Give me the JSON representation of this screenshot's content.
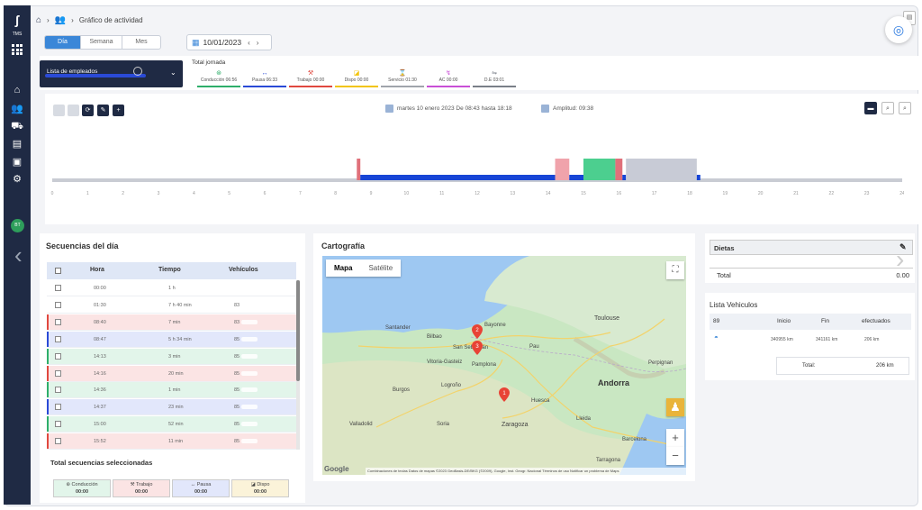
{
  "brand": {
    "logo_text": "ʃ",
    "logo_sub": "TMS"
  },
  "breadcrumb": {
    "current": "Gráfico de actividad"
  },
  "view_tabs": [
    "Día",
    "Semana",
    "Mes"
  ],
  "date_picker": {
    "value": "10/01/2023"
  },
  "employee_select": {
    "label": "Lista de empleados"
  },
  "totals": {
    "title": "Total jornada",
    "items": [
      {
        "label": "Conducción 06:56",
        "color": "#2eae6a",
        "icon": "steering-wheel-icon"
      },
      {
        "label": "Pausa 06:33",
        "color": "#2a4ad6",
        "icon": "pause-icon"
      },
      {
        "label": "Trabajo 00:00",
        "color": "#e0483f",
        "icon": "hammer-icon"
      },
      {
        "label": "Dispo 00:00",
        "color": "#f2c40c",
        "icon": "dispo-icon"
      },
      {
        "label": "Servicio 01:30",
        "color": "#a0a4ab",
        "icon": "hourglass-icon"
      },
      {
        "label": "AC 00:00",
        "color": "#c94fd6",
        "icon": "ac-icon"
      },
      {
        "label": "D.E 03:01",
        "color": "#7a7f88",
        "icon": "de-icon"
      }
    ]
  },
  "chart_info": {
    "range": "martes 10 enero 2023 De 08:43 hasta 18:18",
    "amplitude": "Amplitud: 09:38"
  },
  "chart_data": {
    "type": "bar",
    "title": "",
    "x_axis": {
      "min": 0,
      "max": 24,
      "ticks": [
        0,
        1,
        2,
        3,
        4,
        5,
        6,
        7,
        8,
        9,
        10,
        11,
        12,
        13,
        14,
        15,
        16,
        17,
        18,
        19,
        20,
        21,
        22,
        23,
        24
      ]
    },
    "segments": [
      {
        "start": 8.6,
        "end": 8.7,
        "level": "high",
        "color": "#e0707a"
      },
      {
        "start": 8.7,
        "end": 14.2,
        "level": "low",
        "color": "#1745d6"
      },
      {
        "start": 14.2,
        "end": 14.6,
        "level": "high",
        "color": "#f0a3ab"
      },
      {
        "start": 14.6,
        "end": 15.0,
        "level": "low",
        "color": "#1745d6"
      },
      {
        "start": 15.0,
        "end": 15.9,
        "level": "high",
        "color": "#4ccf8f"
      },
      {
        "start": 15.9,
        "end": 16.1,
        "level": "high",
        "color": "#e0707a"
      },
      {
        "start": 16.1,
        "end": 16.2,
        "level": "low",
        "color": "#1745d6"
      },
      {
        "start": 16.2,
        "end": 18.2,
        "level": "high",
        "color": "#c8cbd6"
      },
      {
        "start": 18.2,
        "end": 18.3,
        "level": "low",
        "color": "#1745d6"
      }
    ]
  },
  "sequences": {
    "title": "Secuencias del día",
    "columns": [
      "Hora",
      "Tiempo",
      "Vehículos"
    ],
    "rows": [
      {
        "hora": "00:00",
        "tiempo": "1 h",
        "vehiculo": "",
        "color": "#ffffff"
      },
      {
        "hora": "01:30",
        "tiempo": "7 h 40 min",
        "vehiculo": "83",
        "color": "#ffffff"
      },
      {
        "hora": "08:40",
        "tiempo": "7 min",
        "vehiculo": "83",
        "color": "#fbe4e4"
      },
      {
        "hora": "08:47",
        "tiempo": "5 h 34 min",
        "vehiculo": "85",
        "color": "#e2e7fb"
      },
      {
        "hora": "14:13",
        "tiempo": "3 min",
        "vehiculo": "85",
        "color": "#e2f5ea"
      },
      {
        "hora": "14:16",
        "tiempo": "20 min",
        "vehiculo": "85",
        "color": "#fbe4e4"
      },
      {
        "hora": "14:36",
        "tiempo": "1 min",
        "vehiculo": "85",
        "color": "#e2f5ea"
      },
      {
        "hora": "14:37",
        "tiempo": "23 min",
        "vehiculo": "85",
        "color": "#e2e7fb"
      },
      {
        "hora": "15:00",
        "tiempo": "52 min",
        "vehiculo": "85",
        "color": "#e2f5ea"
      },
      {
        "hora": "15:52",
        "tiempo": "11 min",
        "vehiculo": "85",
        "color": "#fbe4e4"
      }
    ]
  },
  "selected_totals": {
    "title": "Total secuencias seleccionadas",
    "items": [
      {
        "label": "Conducción",
        "value": "00:00",
        "color": "#e2f5ea",
        "icon": "steering-wheel-icon"
      },
      {
        "label": "Trabajo",
        "value": "00:00",
        "color": "#fbe4e4",
        "icon": "hammer-icon"
      },
      {
        "label": "Pausa",
        "value": "00:00",
        "color": "#e2e7fb",
        "icon": "pause-icon"
      },
      {
        "label": "Dispo",
        "value": "00:00",
        "color": "#fbf3d9",
        "icon": "dispo-icon"
      }
    ]
  },
  "map": {
    "title": "Cartografía",
    "tabs": [
      "Mapa",
      "Satélite"
    ],
    "labels": {
      "andorra": "Andorra",
      "zaragoza": "Zaragoza",
      "toulouse": "Toulouse",
      "bilbao": "Bilbao",
      "santander": "Santander",
      "barcelona": "Barcelona",
      "vitoria": "Vitoria-Gasteiz",
      "pamplona": "Pamplona",
      "huesca": "Huesca",
      "lleida": "Lleida",
      "valladolid": "Valladolid",
      "burgos": "Burgos",
      "logrono": "Logroño",
      "soria": "Soria",
      "san_sebastian": "San Sebastián",
      "bayonne": "Bayonne",
      "pau": "Pau",
      "tarragona": "Tarragona",
      "perpignan": "Perpignan"
    },
    "google": "Google",
    "footer": "Combinaciones de teclas   Datos de mapas ©2023 GeoBasis-DE/BKG (©2009), Google, Inst. Geogr. Nacional   Términos de uso   Notificar un problema de Maps",
    "pins": [
      "2",
      "3",
      "1"
    ]
  },
  "dietas": {
    "title": "Dietas",
    "total_label": "Total",
    "total_value": "0.00"
  },
  "vehicles": {
    "title": "Lista Vehiculos",
    "columns": [
      "89",
      "Inicio",
      "Fin",
      "efectuados"
    ],
    "row": {
      "inicio": "340955 km",
      "fin": "341161 km",
      "efectuados": "206 km"
    },
    "total_label": "Total:",
    "total_value": "206 km"
  }
}
